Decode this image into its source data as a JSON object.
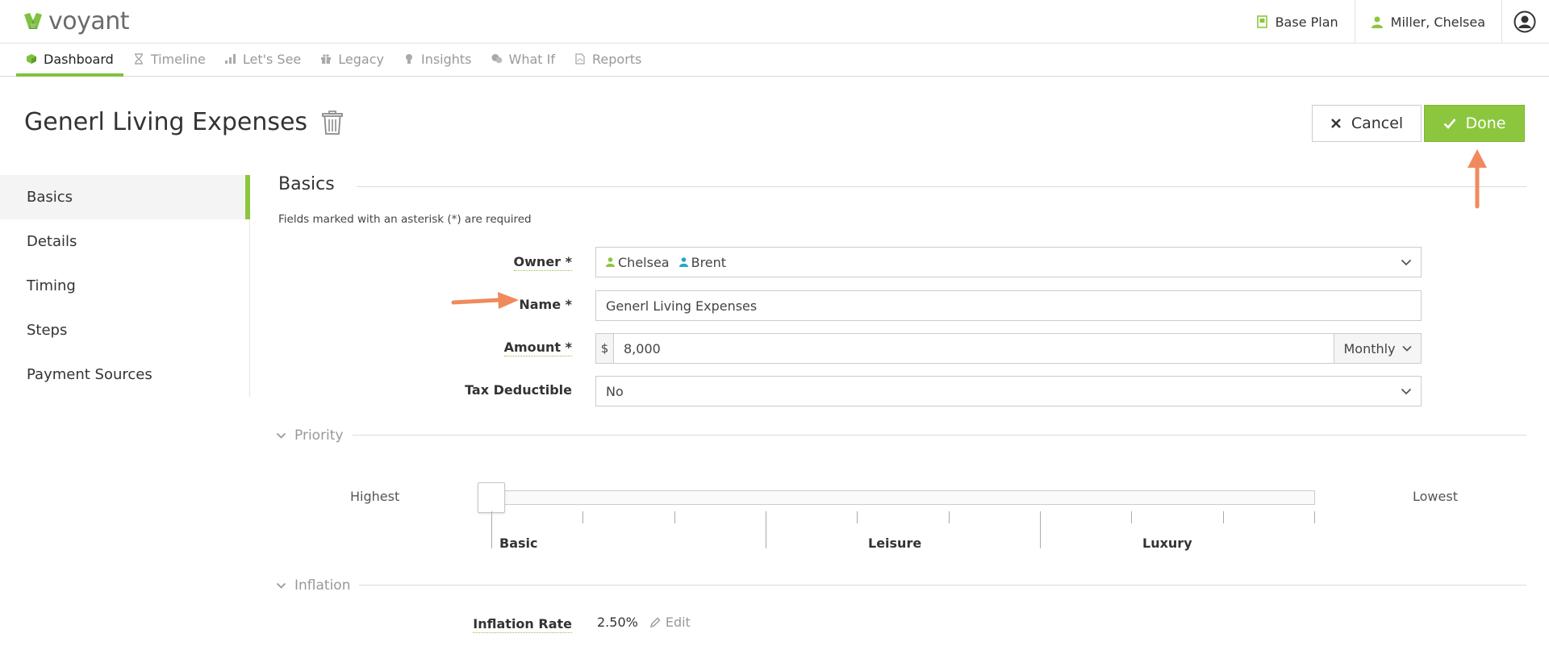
{
  "app": {
    "logo_text": "voyant"
  },
  "header": {
    "plan_label": "Base Plan",
    "user_label": "Miller, Chelsea"
  },
  "nav": {
    "tabs": [
      {
        "label": "Dashboard",
        "icon": "cube-icon",
        "active": true
      },
      {
        "label": "Timeline",
        "icon": "hourglass-icon",
        "active": false
      },
      {
        "label": "Let's See",
        "icon": "bar-chart-icon",
        "active": false
      },
      {
        "label": "Legacy",
        "icon": "gift-icon",
        "active": false
      },
      {
        "label": "Insights",
        "icon": "lightbulb-icon",
        "active": false
      },
      {
        "label": "What If",
        "icon": "chat-icon",
        "active": false
      },
      {
        "label": "Reports",
        "icon": "pdf-icon",
        "active": false
      }
    ]
  },
  "page": {
    "title": "Generl Living Expenses",
    "cancel_label": "Cancel",
    "done_label": "Done"
  },
  "sidemenu": {
    "items": [
      {
        "label": "Basics",
        "active": true
      },
      {
        "label": "Details",
        "active": false
      },
      {
        "label": "Timing",
        "active": false
      },
      {
        "label": "Steps",
        "active": false
      },
      {
        "label": "Payment Sources",
        "active": false
      }
    ]
  },
  "basics": {
    "title": "Basics",
    "required_note": "Fields marked with an asterisk (*) are required",
    "owner_label": "Owner *",
    "owners": [
      {
        "name": "Chelsea",
        "color": "#8cc63f"
      },
      {
        "name": "Brent",
        "color": "#2aa5c4"
      }
    ],
    "name_label": "Name *",
    "name_value": "Generl Living Expenses",
    "amount_label": "Amount *",
    "amount_prefix": "$",
    "amount_value": "8,000",
    "amount_frequency": "Monthly",
    "tax_label": "Tax Deductible",
    "tax_value": "No"
  },
  "priority": {
    "title": "Priority",
    "highest_label": "Highest",
    "lowest_label": "Lowest",
    "levels": [
      "Basic",
      "Leisure",
      "Luxury"
    ],
    "slider_value": 0
  },
  "inflation": {
    "title": "Inflation",
    "rate_label": "Inflation Rate",
    "rate_value": "2.50%",
    "edit_label": "Edit"
  },
  "colors": {
    "accent": "#8cc63f",
    "annotation": "#f08a5d"
  }
}
